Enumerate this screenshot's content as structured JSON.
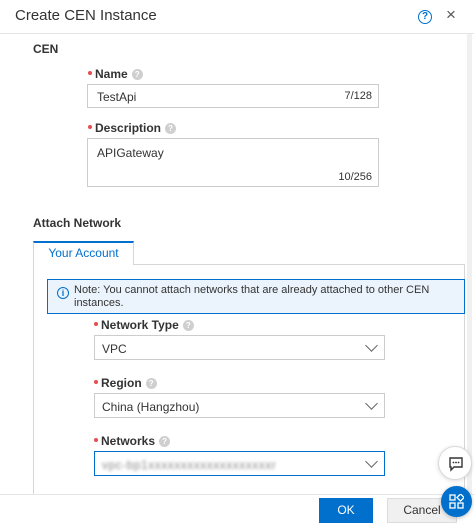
{
  "dialog": {
    "title": "Create CEN Instance",
    "help_icon": "?",
    "close_icon": "×"
  },
  "cen_section": {
    "label": "CEN"
  },
  "name_field": {
    "label": "Name",
    "value": "TestApi",
    "counter": "7/128"
  },
  "description_field": {
    "label": "Description",
    "value": "APIGateway",
    "counter": "10/256"
  },
  "attach_section": {
    "label": "Attach Network",
    "tab_label": "Your Account",
    "notice": "Note: You cannot attach networks that are already attached to other CEN instances."
  },
  "network_type": {
    "label": "Network Type",
    "value": "VPC"
  },
  "region": {
    "label": "Region",
    "value": "China (Hangzhou)"
  },
  "networks": {
    "label": "Networks",
    "value": "vpc-bp1xxxxxxxxxxxxxxxxxxxr"
  },
  "footer": {
    "ok_label": "OK",
    "cancel_label": "Cancel"
  },
  "colors": {
    "accent": "#0070cc",
    "required": "#e84d4d",
    "notice_bg": "#ebf4fc"
  },
  "icons": {
    "help": "help-circle-icon",
    "close": "close-icon",
    "info": "info-icon",
    "chat": "chat-icon",
    "apps": "apps-grid-icon"
  }
}
